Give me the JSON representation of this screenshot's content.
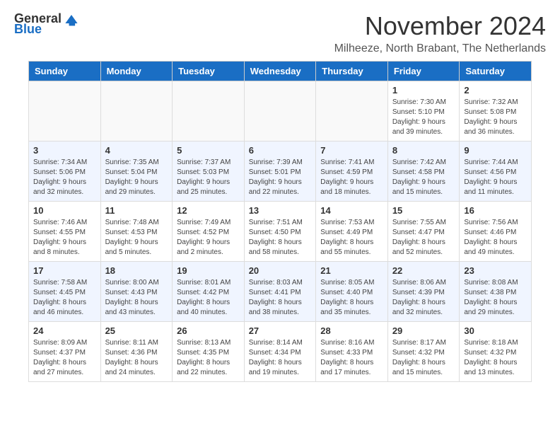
{
  "header": {
    "logo_general": "General",
    "logo_blue": "Blue",
    "month_title": "November 2024",
    "location": "Milheeze, North Brabant, The Netherlands"
  },
  "days_of_week": [
    "Sunday",
    "Monday",
    "Tuesday",
    "Wednesday",
    "Thursday",
    "Friday",
    "Saturday"
  ],
  "weeks": [
    [
      {
        "day": "",
        "empty": true
      },
      {
        "day": "",
        "empty": true
      },
      {
        "day": "",
        "empty": true
      },
      {
        "day": "",
        "empty": true
      },
      {
        "day": "",
        "empty": true
      },
      {
        "day": "1",
        "sunrise": "7:30 AM",
        "sunset": "5:10 PM",
        "daylight": "9 hours and 39 minutes."
      },
      {
        "day": "2",
        "sunrise": "7:32 AM",
        "sunset": "5:08 PM",
        "daylight": "9 hours and 36 minutes."
      }
    ],
    [
      {
        "day": "3",
        "sunrise": "7:34 AM",
        "sunset": "5:06 PM",
        "daylight": "9 hours and 32 minutes."
      },
      {
        "day": "4",
        "sunrise": "7:35 AM",
        "sunset": "5:04 PM",
        "daylight": "9 hours and 29 minutes."
      },
      {
        "day": "5",
        "sunrise": "7:37 AM",
        "sunset": "5:03 PM",
        "daylight": "9 hours and 25 minutes."
      },
      {
        "day": "6",
        "sunrise": "7:39 AM",
        "sunset": "5:01 PM",
        "daylight": "9 hours and 22 minutes."
      },
      {
        "day": "7",
        "sunrise": "7:41 AM",
        "sunset": "4:59 PM",
        "daylight": "9 hours and 18 minutes."
      },
      {
        "day": "8",
        "sunrise": "7:42 AM",
        "sunset": "4:58 PM",
        "daylight": "9 hours and 15 minutes."
      },
      {
        "day": "9",
        "sunrise": "7:44 AM",
        "sunset": "4:56 PM",
        "daylight": "9 hours and 11 minutes."
      }
    ],
    [
      {
        "day": "10",
        "sunrise": "7:46 AM",
        "sunset": "4:55 PM",
        "daylight": "9 hours and 8 minutes."
      },
      {
        "day": "11",
        "sunrise": "7:48 AM",
        "sunset": "4:53 PM",
        "daylight": "9 hours and 5 minutes."
      },
      {
        "day": "12",
        "sunrise": "7:49 AM",
        "sunset": "4:52 PM",
        "daylight": "9 hours and 2 minutes."
      },
      {
        "day": "13",
        "sunrise": "7:51 AM",
        "sunset": "4:50 PM",
        "daylight": "8 hours and 58 minutes."
      },
      {
        "day": "14",
        "sunrise": "7:53 AM",
        "sunset": "4:49 PM",
        "daylight": "8 hours and 55 minutes."
      },
      {
        "day": "15",
        "sunrise": "7:55 AM",
        "sunset": "4:47 PM",
        "daylight": "8 hours and 52 minutes."
      },
      {
        "day": "16",
        "sunrise": "7:56 AM",
        "sunset": "4:46 PM",
        "daylight": "8 hours and 49 minutes."
      }
    ],
    [
      {
        "day": "17",
        "sunrise": "7:58 AM",
        "sunset": "4:45 PM",
        "daylight": "8 hours and 46 minutes."
      },
      {
        "day": "18",
        "sunrise": "8:00 AM",
        "sunset": "4:43 PM",
        "daylight": "8 hours and 43 minutes."
      },
      {
        "day": "19",
        "sunrise": "8:01 AM",
        "sunset": "4:42 PM",
        "daylight": "8 hours and 40 minutes."
      },
      {
        "day": "20",
        "sunrise": "8:03 AM",
        "sunset": "4:41 PM",
        "daylight": "8 hours and 38 minutes."
      },
      {
        "day": "21",
        "sunrise": "8:05 AM",
        "sunset": "4:40 PM",
        "daylight": "8 hours and 35 minutes."
      },
      {
        "day": "22",
        "sunrise": "8:06 AM",
        "sunset": "4:39 PM",
        "daylight": "8 hours and 32 minutes."
      },
      {
        "day": "23",
        "sunrise": "8:08 AM",
        "sunset": "4:38 PM",
        "daylight": "8 hours and 29 minutes."
      }
    ],
    [
      {
        "day": "24",
        "sunrise": "8:09 AM",
        "sunset": "4:37 PM",
        "daylight": "8 hours and 27 minutes."
      },
      {
        "day": "25",
        "sunrise": "8:11 AM",
        "sunset": "4:36 PM",
        "daylight": "8 hours and 24 minutes."
      },
      {
        "day": "26",
        "sunrise": "8:13 AM",
        "sunset": "4:35 PM",
        "daylight": "8 hours and 22 minutes."
      },
      {
        "day": "27",
        "sunrise": "8:14 AM",
        "sunset": "4:34 PM",
        "daylight": "8 hours and 19 minutes."
      },
      {
        "day": "28",
        "sunrise": "8:16 AM",
        "sunset": "4:33 PM",
        "daylight": "8 hours and 17 minutes."
      },
      {
        "day": "29",
        "sunrise": "8:17 AM",
        "sunset": "4:32 PM",
        "daylight": "8 hours and 15 minutes."
      },
      {
        "day": "30",
        "sunrise": "8:18 AM",
        "sunset": "4:32 PM",
        "daylight": "8 hours and 13 minutes."
      }
    ]
  ]
}
